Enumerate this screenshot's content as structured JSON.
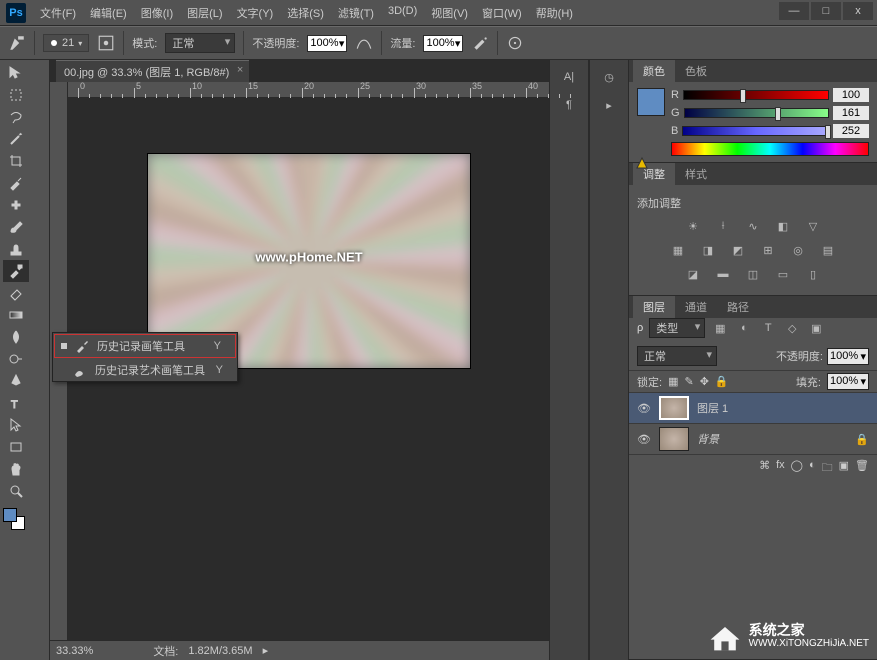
{
  "app": {
    "logo": "Ps"
  },
  "menu": [
    "文件(F)",
    "编辑(E)",
    "图像(I)",
    "图层(L)",
    "文字(Y)",
    "选择(S)",
    "滤镜(T)",
    "3D(D)",
    "视图(V)",
    "窗口(W)",
    "帮助(H)"
  ],
  "window_controls": {
    "min": "—",
    "max": "□",
    "close": "x"
  },
  "options": {
    "brush_size": "21",
    "mode_label": "模式:",
    "mode_value": "正常",
    "opacity_label": "不透明度:",
    "opacity_value": "100%",
    "flow_label": "流量:",
    "flow_value": "100%"
  },
  "doc": {
    "tab": "00.jpg @ 33.3% (图层 1, RGB/8#)"
  },
  "ruler_ticks": [
    0,
    5,
    10,
    15,
    20,
    25,
    30,
    35,
    40
  ],
  "canvas": {
    "watermark": "www.pHome.NET"
  },
  "tool_flyout": {
    "items": [
      {
        "label": "历史记录画笔工具",
        "key": "Y",
        "current": true
      },
      {
        "label": "历史记录艺术画笔工具",
        "key": "Y",
        "current": false
      }
    ]
  },
  "status": {
    "zoom": "33.33%",
    "doc_label": "文档:",
    "doc_size": "1.82M/3.65M"
  },
  "panels": {
    "color": {
      "tabs": [
        "颜色",
        "色板"
      ],
      "channels": {
        "R": {
          "label": "R",
          "value": "100",
          "pos": 39
        },
        "G": {
          "label": "G",
          "value": "161",
          "pos": 63
        },
        "B": {
          "label": "B",
          "value": "252",
          "pos": 98
        }
      }
    },
    "adjust": {
      "tabs": [
        "调整",
        "样式"
      ],
      "title": "添加调整"
    },
    "layers": {
      "tabs": [
        "图层",
        "通道",
        "路径"
      ],
      "kind": "类型",
      "blend": "正常",
      "opacity_label": "不透明度:",
      "opacity": "100%",
      "lock_label": "锁定:",
      "fill_label": "填充:",
      "fill": "100%",
      "items": [
        {
          "name": "图层 1",
          "active": true,
          "locked": false
        },
        {
          "name": "背景",
          "active": false,
          "locked": true
        }
      ]
    }
  },
  "watermark2": {
    "cn": "系统之家",
    "url": "WWW.XiTONGZHiJiA.NET"
  }
}
